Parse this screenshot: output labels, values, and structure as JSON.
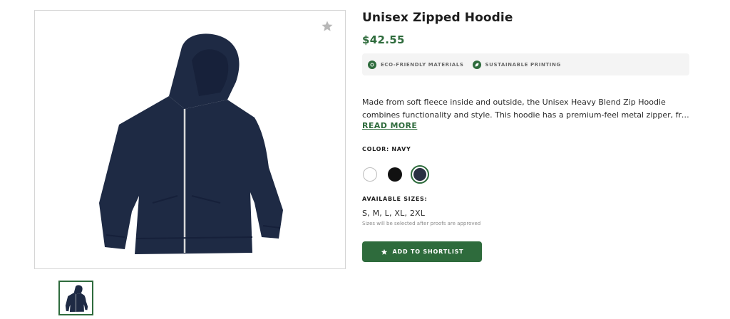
{
  "product": {
    "title": "Unisex Zipped Hoodie",
    "price": "$42.55",
    "badges": [
      {
        "icon": "eco-icon",
        "label": "ECO-FRIENDLY MATERIALS"
      },
      {
        "icon": "leaf-icon",
        "label": "SUSTAINABLE PRINTING"
      }
    ],
    "description_line1": "Made from soft fleece inside and outside, the Unisex Heavy Blend Zip Hoodie",
    "description_line2": "combines functionality and style. This hoodie has a premium-feel metal zipper, fron...",
    "read_more": "READ MORE",
    "color_label": "COLOR: NAVY",
    "colors": [
      {
        "name": "white",
        "hex": "#ffffff",
        "selected": false
      },
      {
        "name": "black",
        "hex": "#111111",
        "selected": false
      },
      {
        "name": "navy",
        "hex": "#2a3142",
        "selected": true
      }
    ],
    "sizes_label": "AVAILABLE SIZES:",
    "sizes_value": "S, M, L, XL, 2XL",
    "sizes_note": "Sizes will be selected after proofs are approved",
    "shortlist_button": "ADD TO SHORTLIST"
  },
  "theme": {
    "accent": "#2e6b3c",
    "hoodie_color": "#1e2a44"
  }
}
